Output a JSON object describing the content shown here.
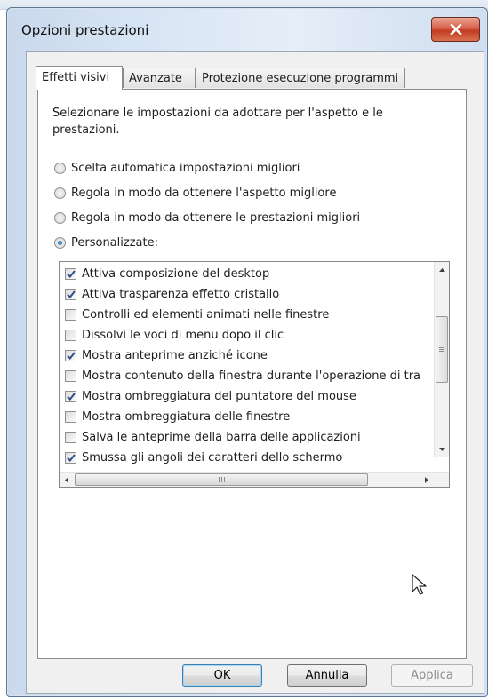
{
  "window": {
    "title": "Opzioni prestazioni"
  },
  "tabs": [
    {
      "label": "Effetti visivi",
      "active": true
    },
    {
      "label": "Avanzate",
      "active": false
    },
    {
      "label": "Protezione esecuzione programmi",
      "active": false
    }
  ],
  "panel": {
    "description": "Selezionare le impostazioni da adottare per l'aspetto e le prestazioni.",
    "radios": [
      {
        "label": "Scelta automatica impostazioni migliori",
        "selected": false
      },
      {
        "label": "Regola in modo da ottenere l'aspetto migliore",
        "selected": false
      },
      {
        "label": "Regola in modo da ottenere le prestazioni migliori",
        "selected": false
      },
      {
        "label": "Personalizzate:",
        "selected": true
      }
    ],
    "effects": [
      {
        "label": "Attiva composizione del desktop",
        "checked": true
      },
      {
        "label": "Attiva trasparenza effetto cristallo",
        "checked": true
      },
      {
        "label": "Controlli ed elementi animati nelle finestre",
        "checked": false
      },
      {
        "label": "Dissolvi le voci di menu dopo il clic",
        "checked": false
      },
      {
        "label": "Mostra anteprime anziché icone",
        "checked": true
      },
      {
        "label": "Mostra contenuto della finestra durante l'operazione di tra",
        "checked": false
      },
      {
        "label": "Mostra ombreggiatura del puntatore del mouse",
        "checked": true
      },
      {
        "label": "Mostra ombreggiatura delle finestre",
        "checked": false
      },
      {
        "label": "Salva le anteprime della barra delle applicazioni",
        "checked": false
      },
      {
        "label": "Smussa gli angoli dei caratteri dello schermo",
        "checked": true
      }
    ]
  },
  "buttons": {
    "ok": "OK",
    "cancel": "Annulla",
    "apply": "Applica"
  },
  "colors": {
    "accent": "#1d63b4",
    "close": "#c23b22",
    "checkmark": "#2c4f8a"
  },
  "icons": {
    "close": "close-icon",
    "cursor": "mouse-pointer-icon"
  }
}
